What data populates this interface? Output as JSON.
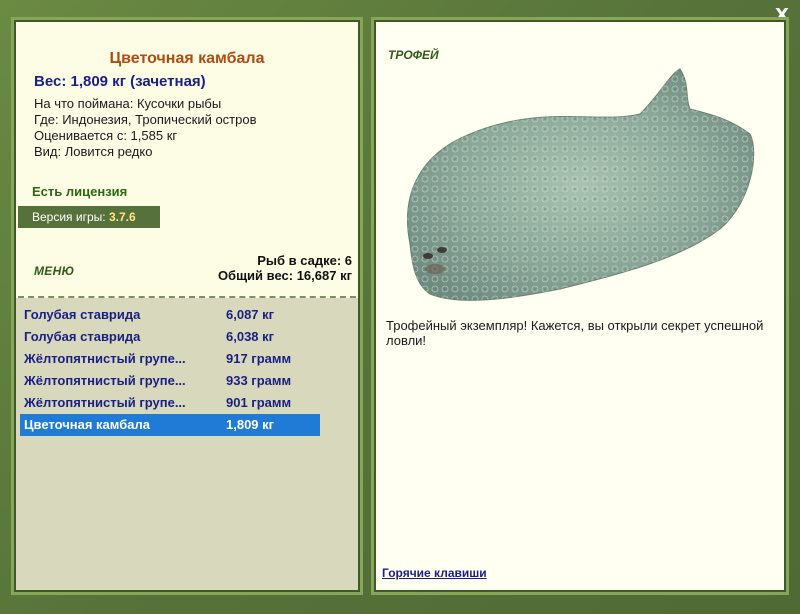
{
  "close_label": "X",
  "fish": {
    "title": "Цветочная камбала",
    "weight": "Вес: 1,809 кг (зачетная)",
    "info": [
      "На что поймана: Кусочки рыбы",
      "Где: Индонезия, Тропический остров",
      "Оценивается с: 1,585 кг",
      "Вид: Ловится редко"
    ]
  },
  "license": "Есть лицензия",
  "version": {
    "label": "Версия игры:",
    "value": "3.7.6"
  },
  "menu_label": "МЕНЮ",
  "cage": {
    "count_line": "Рыб в садке: 6",
    "total_line": "Общий вес: 16,687 кг"
  },
  "catches": [
    {
      "name": "Голубая ставрида",
      "weight": "6,087 кг",
      "selected": false
    },
    {
      "name": "Голубая ставрида",
      "weight": "6,038 кг",
      "selected": false
    },
    {
      "name": "Жёлтопятнистый групе...",
      "weight": "917 грамм",
      "selected": false
    },
    {
      "name": "Жёлтопятнистый групе...",
      "weight": "933 грамм",
      "selected": false
    },
    {
      "name": "Жёлтопятнистый групе...",
      "weight": "901 грамм",
      "selected": false
    },
    {
      "name": "Цветочная камбала",
      "weight": "1,809 кг",
      "selected": true
    }
  ],
  "trophy": {
    "label": "ТРОФЕЙ",
    "text": "Трофейный экземпляр! Кажется, вы открыли секрет успешной ловли!"
  },
  "hotkeys_label": "Горячие клавиши",
  "colors": {
    "frame": "#5e7a3a",
    "panel_bg": "#fdfde6",
    "list_bg": "#d8d8bc",
    "selected": "#1f7bd6",
    "title": "#b34a12",
    "link": "#1a1f86"
  }
}
